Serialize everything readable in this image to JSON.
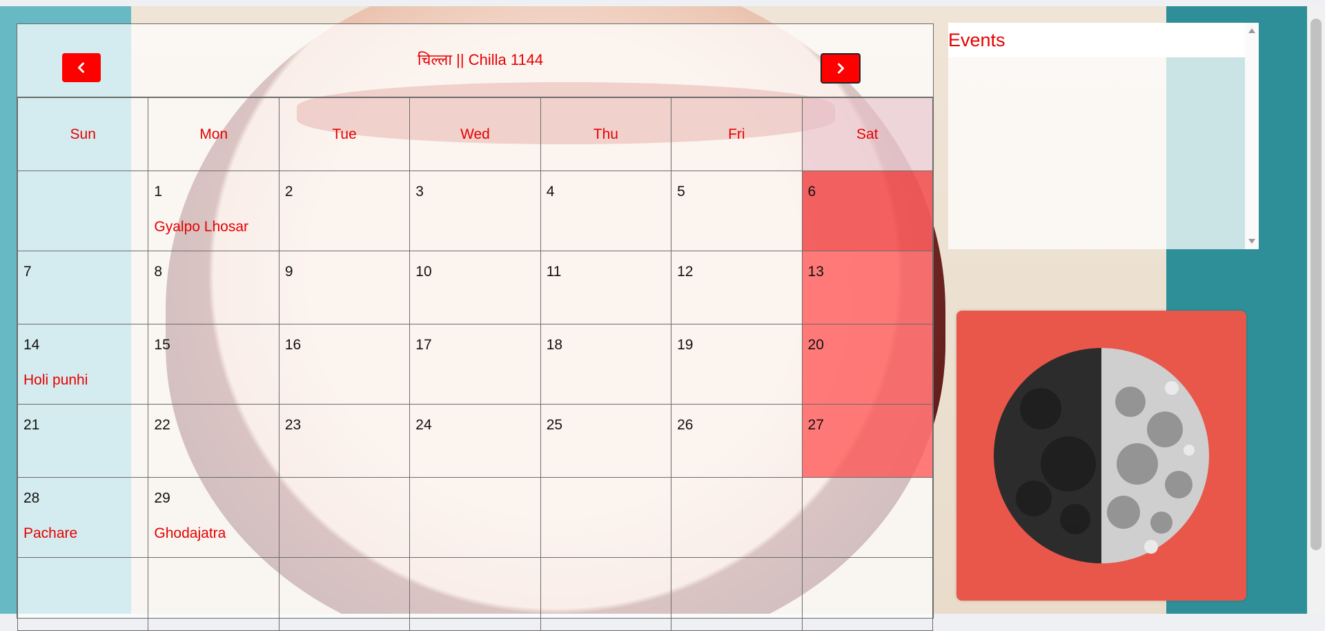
{
  "calendar": {
    "title": "चिल्ला || Chilla 1144",
    "prev_icon": "chevron-left-icon",
    "next_icon": "chevron-right-icon",
    "weekdays": [
      "Sun",
      "Mon",
      "Tue",
      "Wed",
      "Thu",
      "Fri",
      "Sat"
    ],
    "weeks": [
      [
        {
          "day": "",
          "event": ""
        },
        {
          "day": "1",
          "event": "Gyalpo Lhosar"
        },
        {
          "day": "2",
          "event": ""
        },
        {
          "day": "3",
          "event": ""
        },
        {
          "day": "4",
          "event": ""
        },
        {
          "day": "5",
          "event": ""
        },
        {
          "day": "6",
          "event": ""
        }
      ],
      [
        {
          "day": "7",
          "event": ""
        },
        {
          "day": "8",
          "event": ""
        },
        {
          "day": "9",
          "event": ""
        },
        {
          "day": "10",
          "event": ""
        },
        {
          "day": "11",
          "event": ""
        },
        {
          "day": "12",
          "event": ""
        },
        {
          "day": "13",
          "event": ""
        }
      ],
      [
        {
          "day": "14",
          "event": "Holi punhi"
        },
        {
          "day": "15",
          "event": ""
        },
        {
          "day": "16",
          "event": ""
        },
        {
          "day": "17",
          "event": ""
        },
        {
          "day": "18",
          "event": ""
        },
        {
          "day": "19",
          "event": ""
        },
        {
          "day": "20",
          "event": ""
        }
      ],
      [
        {
          "day": "21",
          "event": ""
        },
        {
          "day": "22",
          "event": ""
        },
        {
          "day": "23",
          "event": ""
        },
        {
          "day": "24",
          "event": ""
        },
        {
          "day": "25",
          "event": ""
        },
        {
          "day": "26",
          "event": ""
        },
        {
          "day": "27",
          "event": ""
        }
      ],
      [
        {
          "day": "28",
          "event": "Pachare"
        },
        {
          "day": "29",
          "event": "Ghodajatra"
        },
        {
          "day": "",
          "event": ""
        },
        {
          "day": "",
          "event": ""
        },
        {
          "day": "",
          "event": ""
        },
        {
          "day": "",
          "event": ""
        },
        {
          "day": "",
          "event": ""
        }
      ],
      [
        {
          "day": "",
          "event": ""
        },
        {
          "day": "",
          "event": ""
        },
        {
          "day": "",
          "event": ""
        },
        {
          "day": "",
          "event": ""
        },
        {
          "day": "",
          "event": ""
        },
        {
          "day": "",
          "event": ""
        },
        {
          "day": "",
          "event": ""
        }
      ]
    ],
    "colors": {
      "accent": "#ff0000",
      "text_red": "#e60000",
      "saturday_highlight": "#f03c3c"
    }
  },
  "events_panel": {
    "title": "Events",
    "items": []
  },
  "moon_phase": {
    "icon": "moon-phase-icon",
    "illuminated_fraction": 0.5,
    "lit_side": "right",
    "card_color": "#e8574a"
  }
}
